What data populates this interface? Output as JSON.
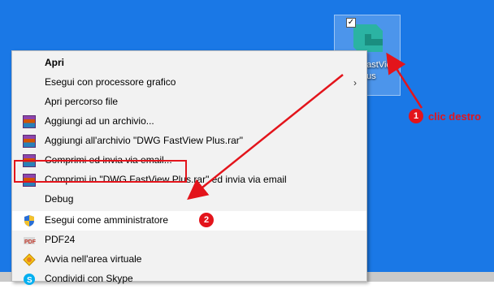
{
  "desktop_icon": {
    "caption": "DWG FastView Plus"
  },
  "annotations": {
    "step1_number": "1",
    "step1_text": "clic destro",
    "step2_number": "2",
    "color": "#e3141b"
  },
  "context_menu": {
    "items": [
      {
        "label": "Apri",
        "icon": "none",
        "bold": true
      },
      {
        "label": "Esegui con processore grafico",
        "icon": "none",
        "submenu": true
      },
      {
        "label": "Apri percorso file",
        "icon": "none"
      },
      {
        "label": "Aggiungi ad un archivio...",
        "icon": "winrar-icon"
      },
      {
        "label": "Aggiungi all'archivio \"DWG FastView Plus.rar\"",
        "icon": "winrar-icon"
      },
      {
        "label": "Comprimi ed invia via email...",
        "icon": "winrar-icon"
      },
      {
        "label": "Comprimi in \"DWG FastView Plus.rar\" ed invia via email",
        "icon": "winrar-icon"
      },
      {
        "label": "Debug",
        "icon": "none"
      },
      {
        "label": "Esegui come amministratore",
        "icon": "uac-shield-icon",
        "highlighted": true
      },
      {
        "label": "PDF24",
        "icon": "pdf24-icon"
      },
      {
        "label": "Avvia nell'area virtuale",
        "icon": "sandbox-icon"
      },
      {
        "label": "Condividi con Skype",
        "icon": "skype-icon"
      }
    ]
  }
}
